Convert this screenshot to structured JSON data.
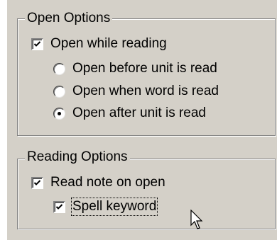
{
  "open_options": {
    "title": "Open Options",
    "open_while_reading": {
      "label": "Open while reading",
      "checked": true
    },
    "radios": [
      {
        "label": "Open before unit is read",
        "selected": false
      },
      {
        "label": "Open when word is read",
        "selected": false
      },
      {
        "label": "Open after unit is read",
        "selected": true
      }
    ]
  },
  "reading_options": {
    "title": "Reading Options",
    "read_note_on_open": {
      "label": "Read note on open",
      "checked": true
    },
    "spell_keyword": {
      "label": "Spell keyword",
      "checked": true,
      "focused": true
    }
  },
  "cursor": {
    "icon": "arrow-cursor-icon"
  },
  "colors": {
    "face": "#d4d0c8",
    "shadow": "#808080",
    "highlight": "#ffffff",
    "text": "#000000"
  }
}
